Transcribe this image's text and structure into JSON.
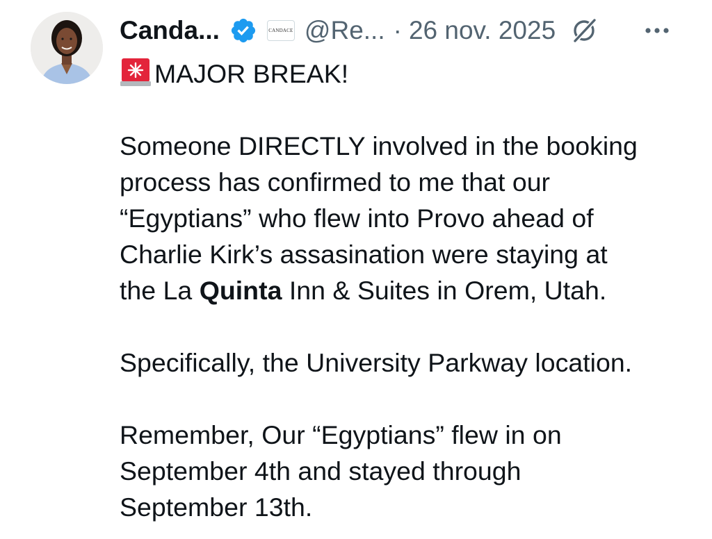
{
  "author": {
    "display_name": "Canda...",
    "handle": "@Re...",
    "separator": "·",
    "timestamp": "26 nov. 2025",
    "affiliate_badge_text": "CANDACE",
    "verified_color": "#1d9bf0"
  },
  "icons": {
    "avatar": "profile-photo",
    "verified": "verified-badge-icon",
    "affiliate": "affiliate-badge-icon",
    "grok": "grok-icon",
    "more": "more-options-icon",
    "siren": "rotating-light-emoji"
  },
  "post": {
    "headline": "MAJOR BREAK!",
    "paragraph1": [
      "Someone DIRECTLY involved in the booking",
      "process has confirmed to me that our",
      "“Egyptians” who flew into Provo ahead of",
      "Charlie Kirk’s assasination were staying at"
    ],
    "paragraph1_last_line": {
      "before": "the La ",
      "bold": "Quinta",
      "after": " Inn & Suites in Orem, Utah."
    },
    "paragraph2": "Specifically, the University Parkway location.",
    "paragraph3": [
      "Remember, Our “Egyptians” flew in on",
      "September 4th and stayed through",
      "September 13th."
    ]
  },
  "colors": {
    "text_primary": "#0f1419",
    "text_secondary": "#536471",
    "background": "#ffffff"
  }
}
